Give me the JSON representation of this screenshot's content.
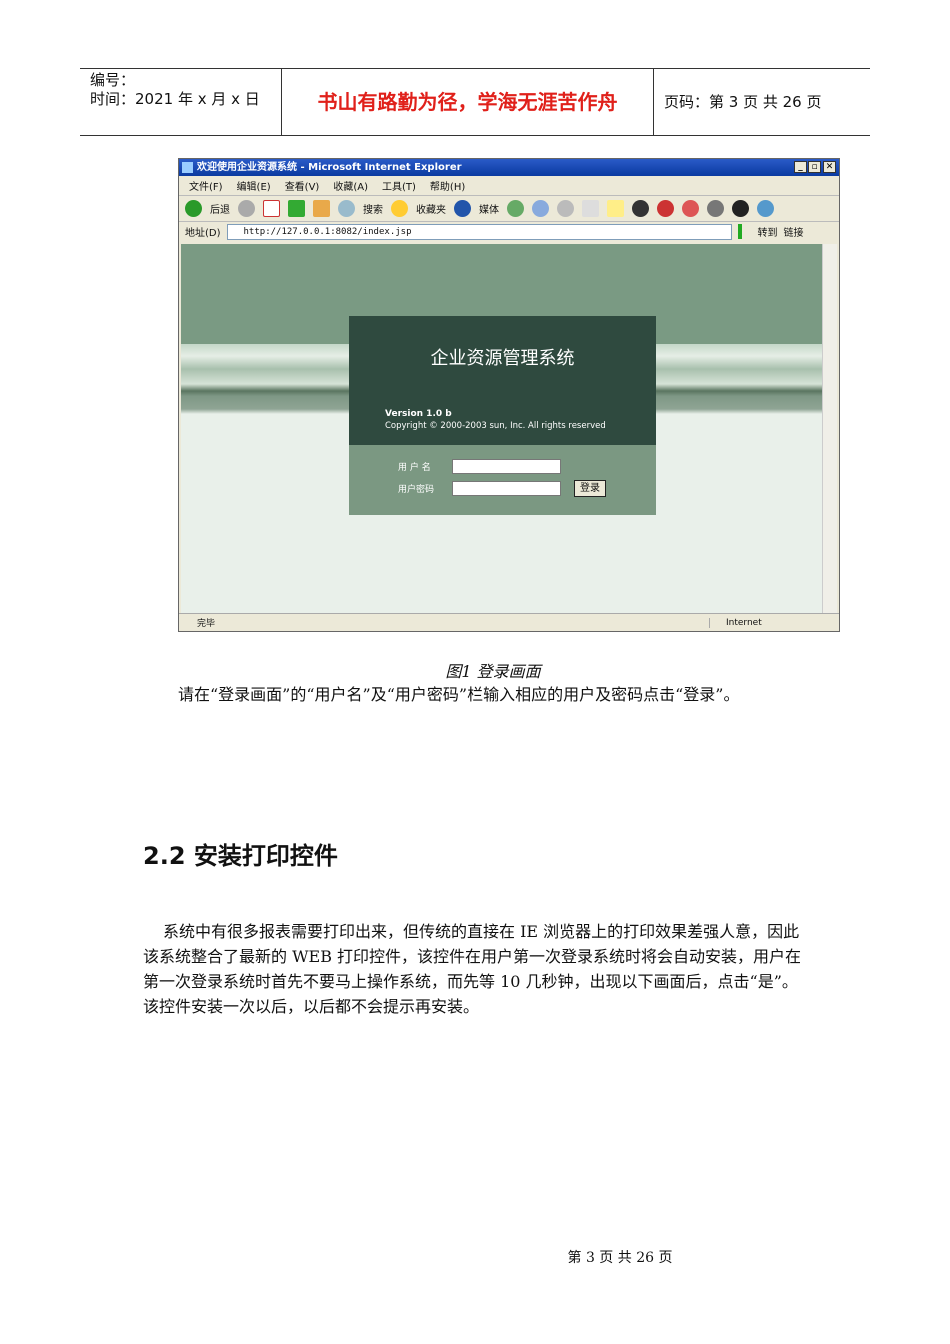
{
  "header": {
    "number_label": "编号：",
    "time_label": "时间：2021 年 x 月 x 日",
    "motto": "书山有路勤为径，学海无涯苦作舟",
    "page_label": "页码：第 3 页  共 26 页"
  },
  "browser": {
    "title": "欢迎使用企业资源系统 - Microsoft Internet Explorer",
    "menu": [
      "文件(F)",
      "编辑(E)",
      "查看(V)",
      "收藏(A)",
      "工具(T)",
      "帮助(H)"
    ],
    "toolbar": {
      "back": "后退",
      "search": "搜索",
      "favorites": "收藏夹",
      "media": "媒体"
    },
    "address_label": "地址(D)",
    "url": "http://127.0.0.1:8082/index.jsp",
    "go": "转到",
    "links": "链接",
    "status": "完毕",
    "zone": "Internet"
  },
  "app": {
    "title": "企业资源管理系统",
    "version": "Version 1.0 b",
    "copyright": "Copyright © 2000-2003 sun, Inc. All rights reserved",
    "username_label": "用 户 名",
    "password_label": "用户密码",
    "login_button": "登录",
    "username_value": "",
    "password_value": ""
  },
  "caption": "图1 登录画面",
  "para1": "请在“登录画面”的“用户名”及“用户密码”栏输入相应的用户及密码点击“登录”。",
  "heading": "2.2 安装打印控件",
  "para2": "系统中有很多报表需要打印出来，但传统的直接在 IE 浏览器上的打印效果差强人意，因此该系统整合了最新的 WEB 打印控件，该控件在用户第一次登录系统时将会自动安装，用户在第一次登录系统时首先不要马上操作系统，而先等 10 几秒钟，出现以下画面后，点击“是”。该控件安装一次以后，以后都不会提示再安装。",
  "footer": "第 3 页 共 26 页"
}
